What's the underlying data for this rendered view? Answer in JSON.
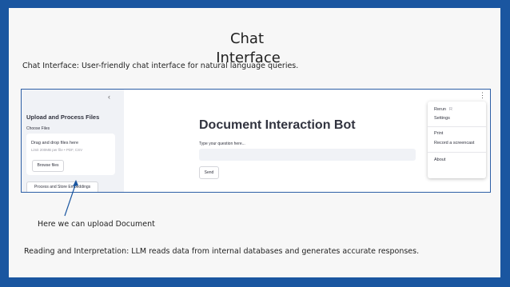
{
  "slide": {
    "title_line1": "Chat",
    "title_line2": "Interface",
    "caption_top": "Chat Interface: User-friendly chat interface for natural language queries.",
    "caption_arrow": "Here we can upload Document",
    "caption_bottom": "Reading and Interpretation: LLM reads data from internal databases and generates accurate responses."
  },
  "app": {
    "sidebar": {
      "collapse_icon": "chevron-left-icon",
      "title": "Upload and Process Files",
      "choose_files_label": "Choose Files",
      "uploader_title": "Drag and drop files here",
      "uploader_limit": "Limit 200MB per file • PDF, CSV",
      "browse_button": "Browse files",
      "process_button": "Process and Store Embeddings"
    },
    "main": {
      "title": "Document Interaction Bot",
      "question_label": "Type your question here...",
      "question_value": "",
      "send_button": "Send"
    },
    "menu": {
      "items": [
        {
          "label": "Rerun",
          "shortcut": "R"
        },
        {
          "label": "Settings"
        },
        {
          "label": "Print"
        },
        {
          "label": "Record a screencast"
        },
        {
          "label": "About"
        }
      ]
    }
  },
  "colors": {
    "frame": "#1a56a0",
    "screenshot_border": "#2d5fa6",
    "sidebar_bg": "#f0f2f6"
  }
}
